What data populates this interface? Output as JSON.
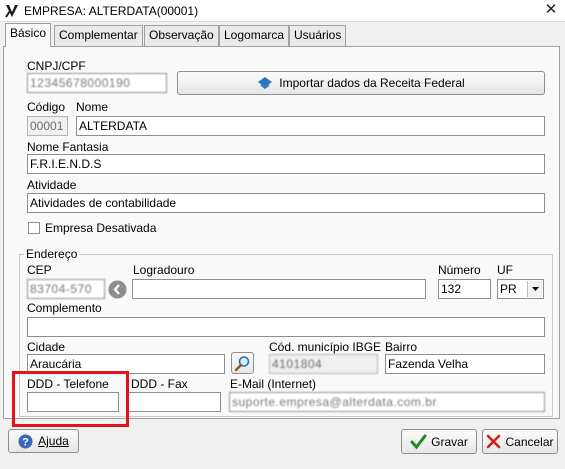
{
  "window": {
    "title": "EMPRESA: ALTERDATA(00001)",
    "close_glyph": "✕"
  },
  "tabs": [
    {
      "label": "Básico",
      "active": true
    },
    {
      "label": "Complementar",
      "active": false
    },
    {
      "label": "Observação",
      "active": false
    },
    {
      "label": "Logomarca",
      "active": false
    },
    {
      "label": "Usuários",
      "active": false
    }
  ],
  "form": {
    "cnpj_label": "CNPJ/CPF",
    "cnpj_value": "12345678000190",
    "importar_button": "Importar dados da Receita Federal",
    "codigo_label": "Código",
    "codigo_value": "00001",
    "nome_label": "Nome",
    "nome_value": "ALTERDATA",
    "fantasia_label": "Nome Fantasia",
    "fantasia_value": "F.R.I.E.N.D.S",
    "atividade_label": "Atividade",
    "atividade_value": "Atividades de contabilidade",
    "desativada_label": "Empresa Desativada",
    "desativada_checked": false
  },
  "endereco": {
    "group_label": "Endereço",
    "cep_label": "CEP",
    "cep_value": "83704-570",
    "logradouro_label": "Logradouro",
    "logradouro_value": "",
    "numero_label": "Número",
    "numero_value": "132",
    "uf_label": "UF",
    "uf_value": "PR",
    "complemento_label": "Complemento",
    "complemento_value": "",
    "cidade_label": "Cidade",
    "cidade_value": "Araucária",
    "ibge_label": "Cód. município IBGE",
    "ibge_value": "4101804",
    "bairro_label": "Bairro",
    "bairro_value": "Fazenda Velha",
    "ddd_tel_label": "DDD - Telefone",
    "ddd_tel_value": "",
    "ddd_fax_label": "DDD - Fax",
    "ddd_fax_value": "",
    "email_label": "E-Mail (Internet)",
    "email_value": "suporte.empresa@alterdata.com.br"
  },
  "buttons": {
    "ajuda": "Ajuda",
    "gravar": "Gravar",
    "cancelar": "Cancelar"
  },
  "colors": {
    "highlight": "#e3121d",
    "help_icon": "#3a67b5",
    "confirm_check": "#1e8a1e",
    "cancel_x": "#d21e1e"
  },
  "icons": {
    "title": "app-logo-icon",
    "importar": "receita-federal-icon",
    "cep_lookup": "cep-search-icon",
    "cidade_search": "magnifier-icon",
    "uf_dropdown": "chevron-down-icon",
    "ajuda": "help-icon",
    "gravar": "check-icon",
    "cancelar": "cancel-x-icon"
  }
}
